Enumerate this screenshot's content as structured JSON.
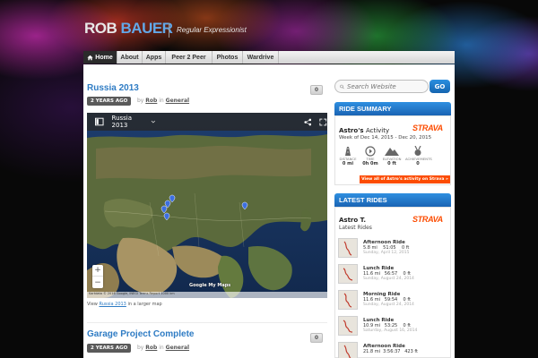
{
  "header": {
    "logo_first": "ROB",
    "logo_last": "BAUER",
    "tagline": "Regular Expressionist"
  },
  "nav": {
    "items": [
      {
        "label": "Home",
        "active": true
      },
      {
        "label": "About"
      },
      {
        "label": "Apps"
      },
      {
        "label": "Peer 2 Peer"
      },
      {
        "label": "Photos"
      },
      {
        "label": "Wardrive"
      }
    ]
  },
  "posts": [
    {
      "title": "Russia 2013",
      "age": "2 YEARS AGO",
      "by": "by",
      "author": "Rob",
      "in": "in",
      "category": "General",
      "comments": "0"
    },
    {
      "title": "Garage Project Complete",
      "age": "2 YEARS AGO",
      "by": "by",
      "author": "Rob",
      "in": "in",
      "category": "General",
      "comments": "0"
    }
  ],
  "map": {
    "title": "Russia 2013",
    "zoom_in": "+",
    "zoom_out": "−",
    "google_logo": "Google My Maps",
    "attribution": "Kartdata © 2016 Google, INEGI  Terms  Report  1000 km",
    "caption_prefix": "View",
    "caption_link": "Russia 2013",
    "caption_suffix": "in a larger map"
  },
  "search": {
    "placeholder": "Search Website",
    "button": "GO"
  },
  "ride_summary": {
    "heading": "RIDE SUMMARY",
    "owner": "Astro's",
    "owner_suffix": "Activity",
    "week": "Week of Dec 14, 2015 - Dec 20, 2015",
    "stats": [
      {
        "label": "DISTANCE",
        "value": "0 mi",
        "icon": "road-icon"
      },
      {
        "label": "TIME",
        "value": "0h 0m",
        "icon": "clock-icon"
      },
      {
        "label": "ELEVATION",
        "value": "0 ft",
        "icon": "mountain-icon"
      },
      {
        "label": "ACHIEVEMENTS",
        "value": "0",
        "icon": "medal-icon"
      }
    ],
    "view_all": "View all of Astro's activity on Strava »",
    "strava": "STRAVA"
  },
  "latest_rides": {
    "heading": "LATEST RIDES",
    "owner": "Astro T.",
    "subtitle": "Latest Rides",
    "strava": "STRAVA",
    "rides": [
      {
        "name": "Afternoon Ride",
        "distance": "5.8 mi",
        "time": "51:05",
        "elev": "0 ft",
        "date": "Sunday, April 12, 2015"
      },
      {
        "name": "Lunch Ride",
        "distance": "11.6 mi",
        "time": "56:57",
        "elev": "0 ft",
        "date": "Sunday, August 24, 2014"
      },
      {
        "name": "Morning Ride",
        "distance": "11.6 mi",
        "time": "59:54",
        "elev": "0 ft",
        "date": "Sunday, August 24, 2014"
      },
      {
        "name": "Lunch Ride",
        "distance": "10.9 mi",
        "time": "53:25",
        "elev": "0 ft",
        "date": "Saturday, August 16, 2014"
      },
      {
        "name": "Afternoon Ride",
        "distance": "21.8 mi",
        "time": "3:56:37",
        "elev": "423 ft",
        "date": ""
      }
    ]
  }
}
